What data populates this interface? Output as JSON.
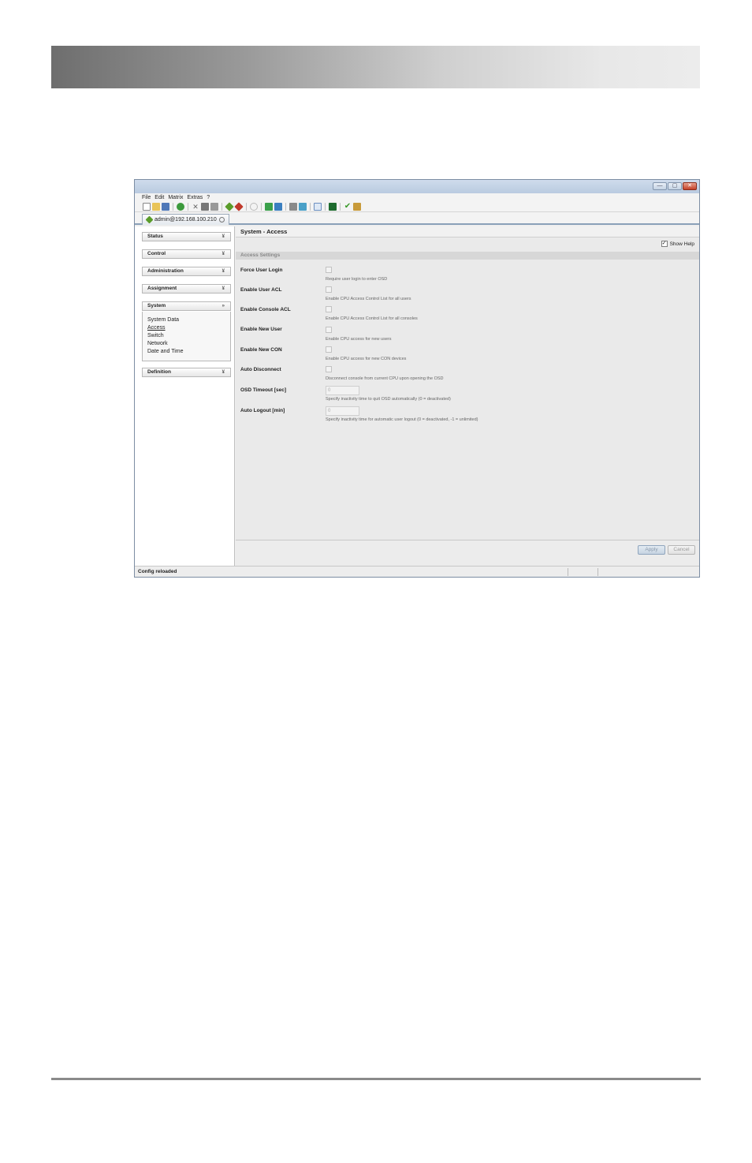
{
  "window": {
    "controls": {
      "minimize": "—",
      "maximize": "▢",
      "close": "✕"
    }
  },
  "menu": [
    {
      "label": "File"
    },
    {
      "label": "Edit"
    },
    {
      "label": "Matrix"
    },
    {
      "label": "Extras"
    },
    {
      "label": "?"
    }
  ],
  "toolbar": {
    "icons": [
      "new-icon",
      "open-icon",
      "save-icon",
      "separator",
      "reload-icon",
      "separator",
      "cut-icon",
      "copy-icon",
      "paste-icon",
      "separator",
      "connect-icon",
      "disconnect-icon",
      "separator",
      "settings-icon",
      "separator",
      "download-icon",
      "upload-icon",
      "separator",
      "document-icon",
      "export-icon",
      "separator",
      "report-icon",
      "separator",
      "monitor-icon",
      "separator",
      "check-icon",
      "tools-icon"
    ]
  },
  "tab": {
    "label": "admin@192.168.100.210"
  },
  "sidebar": {
    "sections": [
      {
        "label": "Status",
        "chevron": "¥"
      },
      {
        "label": "Control",
        "chevron": "¥"
      },
      {
        "label": "Administration",
        "chevron": "¥"
      },
      {
        "label": "Assignment",
        "chevron": "¥"
      },
      {
        "label": "System",
        "chevron": "»"
      },
      {
        "label": "Definition",
        "chevron": "¥"
      }
    ],
    "system_items": [
      "System Data",
      "Access",
      "Switch",
      "Network",
      "Date and Time"
    ]
  },
  "content": {
    "title": "System - Access",
    "show_help": {
      "label": "Show Help",
      "checked_mark": "✓"
    },
    "section_title": "Access Settings",
    "rows": [
      {
        "label": "Force User Login",
        "help": "Require user login to enter OSD"
      },
      {
        "label": "Enable User ACL",
        "help": "Enable CPU Access Control List for all users"
      },
      {
        "label": "Enable Console ACL",
        "help": "Enable CPU Access Control List for all consoles"
      },
      {
        "label": "Enable New User",
        "help": "Enable CPU access for new users"
      },
      {
        "label": "Enable New CON",
        "help": "Enable CPU access for new CON devices"
      },
      {
        "label": "Auto Disconnect",
        "help": "Disconnect console from current CPU upon opening the OSD"
      },
      {
        "label": "OSD Timeout [sec]",
        "value": "0",
        "help": "Specify inactivity time to quit OSD automatically (0 = deactivated)"
      },
      {
        "label": "Auto Logout [min]",
        "value": "0",
        "help": "Specify inactivity time for automatic user logout (0 = deactivated, -1 = unlimited)"
      }
    ],
    "buttons": {
      "apply": "Apply",
      "cancel": "Cancel"
    }
  },
  "status": {
    "message": "Config reloaded"
  },
  "colors": {
    "header_dark": "#6e6e6e",
    "header_light": "#ececec",
    "accent_blue": "#8aa0b8",
    "close_red": "#c5422a"
  }
}
